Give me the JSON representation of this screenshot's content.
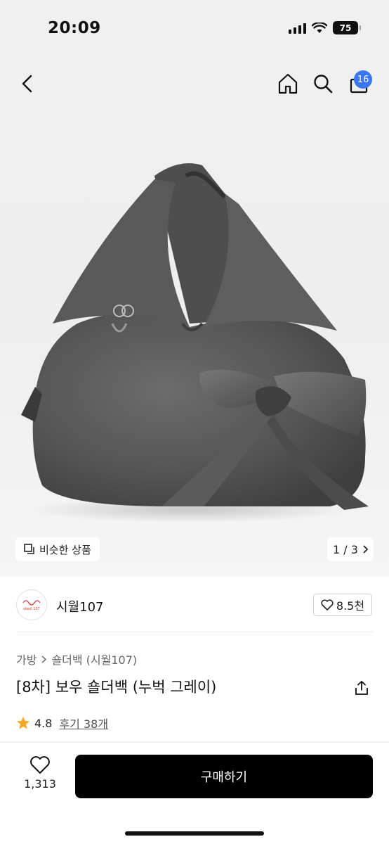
{
  "status": {
    "time": "20:09",
    "battery": "75"
  },
  "nav": {
    "cart_count": "16"
  },
  "gallery": {
    "similar_label": "비슷한 상품",
    "pager": "1 / 3"
  },
  "brand": {
    "name": "시월107",
    "logo_text": "siwol.107",
    "likes": "8.5천"
  },
  "breadcrumb": {
    "category": "가방",
    "subcategory": "숄더백 (시월107)"
  },
  "product": {
    "title": "[8차] 보우 숄더백 (누벅 그레이)",
    "rating": "4.8",
    "reviews": "후기 38개"
  },
  "bottom": {
    "wish_count": "1,313",
    "buy_label": "구매하기"
  },
  "colors": {
    "accent": "#3a76f0",
    "star": "#f6a623",
    "bag": "#5a5a5a"
  }
}
